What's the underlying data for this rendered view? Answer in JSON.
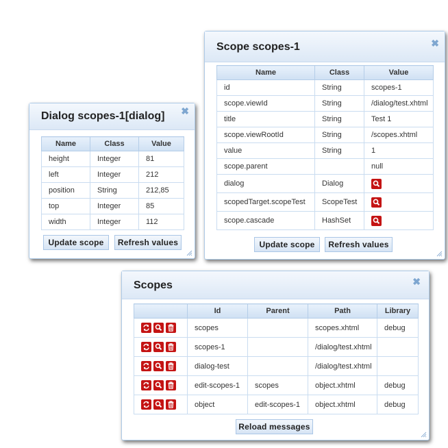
{
  "dialog_small": {
    "title": "Dialog scopes-1[dialog]",
    "headers": [
      "Name",
      "Class",
      "Value"
    ],
    "rows": [
      [
        "height",
        "Integer",
        "81"
      ],
      [
        "left",
        "Integer",
        "212"
      ],
      [
        "position",
        "String",
        "212,85"
      ],
      [
        "top",
        "Integer",
        "85"
      ],
      [
        "width",
        "Integer",
        "112"
      ]
    ],
    "update_label": "Update scope",
    "refresh_label": "Refresh values"
  },
  "dialog_scope": {
    "title": "Scope scopes-1",
    "headers": [
      "Name",
      "Class",
      "Value"
    ],
    "rows": [
      [
        "id",
        "String",
        "scopes-1"
      ],
      [
        "scope.viewId",
        "String",
        "/dialog/test.xhtml"
      ],
      [
        "title",
        "String",
        "Test 1"
      ],
      [
        "scope.viewRootId",
        "String",
        "/scopes.xhtml"
      ],
      [
        "value",
        "String",
        "1"
      ],
      [
        "scope.parent",
        "",
        "null"
      ],
      [
        "dialog",
        "Dialog",
        ""
      ],
      [
        "scopedTarget.scopeTest",
        "ScopeTest",
        ""
      ],
      [
        "scope.cascade",
        "HashSet",
        ""
      ]
    ],
    "update_label": "Update scope",
    "refresh_label": "Refresh values"
  },
  "dialog_scopes": {
    "title": "Scopes",
    "headers": [
      "",
      "Id",
      "Parent",
      "Path",
      "Library"
    ],
    "rows": [
      [
        "scopes",
        "",
        "scopes.xhtml",
        "debug"
      ],
      [
        "scopes-1",
        "",
        "/dialog/test.xhtml",
        ""
      ],
      [
        "dialog-test",
        "",
        "/dialog/test.xhtml",
        ""
      ],
      [
        "edit-scopes-1",
        "scopes",
        "object.xhtml",
        "debug"
      ],
      [
        "object",
        "edit-scopes-1",
        "object.xhtml",
        "debug"
      ]
    ],
    "reload_label": "Reload messages"
  },
  "close_glyph": "✖",
  "icons": {
    "close": "close-icon",
    "inspect": "magnifier-icon",
    "refresh": "refresh-icon",
    "delete": "trash-icon",
    "resize": "resize-grip-icon"
  },
  "colors": {
    "accent": "#c41414",
    "header_bg": "#dce8f6",
    "border": "#aecbe8"
  }
}
